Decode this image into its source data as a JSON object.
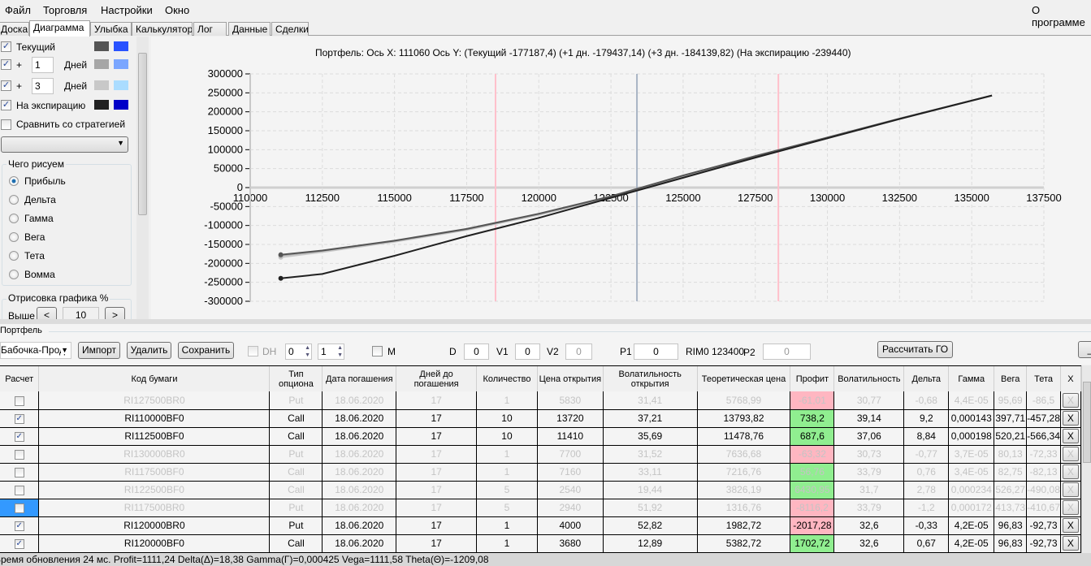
{
  "menu": {
    "items": [
      "Файл",
      "Торговля",
      "Настройки",
      "Окно"
    ],
    "about": "О программе"
  },
  "tabs": [
    "Доска",
    "Диаграмма",
    "Улыбка",
    "Калькулятор",
    "Лог",
    "Данные",
    "Сделки"
  ],
  "active_tab": "Диаграмма",
  "left_panel": {
    "current_label": "Текущий",
    "plus": "+",
    "days_label": "Дней",
    "days1": "1",
    "days2": "3",
    "expiration_label": "На экспирацию",
    "compare_label": "Сравнить со стратегией",
    "strategy_select": "",
    "colors": {
      "current": [
        "#555555",
        "#2952ff"
      ],
      "plus1": [
        "#a6a6a6",
        "#7aa6ff"
      ],
      "plus3": [
        "#c8c8c8",
        "#aadcff"
      ],
      "expiration": [
        "#202020",
        "#0000c8"
      ]
    },
    "what_group": "Чего рисуем",
    "what_options": [
      "Прибыль",
      "Дельта",
      "Гамма",
      "Вега",
      "Тета",
      "Вомма"
    ],
    "what_selected": "Прибыль",
    "draw_group": "Отрисовка графика %",
    "above_label": "Выше",
    "prev": "<",
    "next": ">",
    "draw_value": "10"
  },
  "chart_title": "Портфель: Ось X: 111060 Ось Y:  (Текущий -177187,4)  (+1 дн. -179437,14)  (+3 дн. -184139,82)  (На экспирацию -239440)",
  "chart_data": {
    "type": "line",
    "xlim": [
      110000,
      137500
    ],
    "ylim": [
      -300000,
      300000
    ],
    "x_ticks": [
      "110000",
      "112500",
      "115000",
      "117500",
      "120000",
      "122500",
      "125000",
      "127500",
      "130000",
      "132500",
      "135000",
      "137500"
    ],
    "y_ticks": [
      "300000",
      "250000",
      "200000",
      "150000",
      "100000",
      "50000",
      "0",
      "-50000",
      "-100000",
      "-150000",
      "-200000",
      "-250000",
      "-300000"
    ],
    "grid": true,
    "vertical_markers": [
      {
        "x": 118500,
        "color": "#ffc0cb"
      },
      {
        "x": 123400,
        "color": "#a8b4c4"
      },
      {
        "x": 128300,
        "color": "#ffc0cb"
      }
    ],
    "series": [
      {
        "color": "#c8c8c8",
        "x": [
          111060,
          112500,
          115000,
          117500,
          120000,
          122500,
          125000,
          127500,
          130000,
          132500,
          135700
        ],
        "y": [
          -184140,
          -170000,
          -143000,
          -112000,
          -72000,
          -26000,
          30000,
          82000,
          132000,
          182000,
          243000
        ]
      },
      {
        "color": "#a6a6a6",
        "x": [
          111060,
          112500,
          115000,
          117500,
          120000,
          122500,
          125000,
          127500,
          130000,
          132500,
          135700
        ],
        "y": [
          -179437,
          -167000,
          -141000,
          -110000,
          -70000,
          -24000,
          31000,
          83000,
          132000,
          182000,
          243000
        ]
      },
      {
        "color": "#555555",
        "x": [
          111060,
          112500,
          115000,
          117500,
          120000,
          122500,
          125000,
          127500,
          130000,
          132500,
          135700
        ],
        "y": [
          -177187,
          -166000,
          -140000,
          -109000,
          -69000,
          -23000,
          32000,
          83000,
          132000,
          182000,
          243000
        ]
      },
      {
        "color": "#202020",
        "x": [
          111060,
          112500,
          115000,
          117500,
          120000,
          122500,
          125000,
          127500,
          130000,
          132500,
          135700
        ],
        "y": [
          -239440,
          -228000,
          -180000,
          -128000,
          -80000,
          -27000,
          26000,
          79000,
          130000,
          181000,
          243000
        ]
      }
    ]
  },
  "portfolio": {
    "group_title": "Портфель",
    "strategy": "Бабочка-Прод",
    "import": "Импорт",
    "delete": "Удалить",
    "save": "Сохранить",
    "dh_label": "DH",
    "spin1": "0",
    "spin2": "1",
    "m_label": "M",
    "d_label": "D",
    "d_value": "0",
    "v1_label": "V1",
    "v1_value": "0",
    "v2_label": "V2",
    "v2_value": "0",
    "p1_label": "P1",
    "p1_value": "0",
    "rim_label": "RIM0 123400",
    "p2_label": "P2",
    "p2_value": "0",
    "calc_go": "Рассчитать ГО",
    "minimize": "_"
  },
  "table": {
    "columns": [
      "Расчет",
      "Код бумаги",
      "Тип опциона",
      "Дата погашения",
      "Дней до погашения",
      "Количество",
      "Цена открытия",
      "Волатильность открытия",
      "Теоретическая цена",
      "Профит",
      "Волатильность",
      "Дельта",
      "Гамма",
      "Вега",
      "Тета",
      "X"
    ],
    "rows": [
      {
        "checked": false,
        "code": "RI127500BR0",
        "type": "Put",
        "date": "18.06.2020",
        "days": "17",
        "qty": "1",
        "open": "5830",
        "open_vol": "31,41",
        "theo": "5768,99",
        "profit": "-61,01",
        "vol": "30,77",
        "delta": "-0,68",
        "gamma": "4,4E-05",
        "vega": "95,69",
        "theta": "-86,5",
        "x": "X"
      },
      {
        "checked": true,
        "code": "RI110000BF0",
        "type": "Call",
        "date": "18.06.2020",
        "days": "17",
        "qty": "10",
        "open": "13720",
        "open_vol": "37,21",
        "theo": "13793,82",
        "profit": "738,2",
        "vol": "39,14",
        "delta": "9,2",
        "gamma": "0,000143",
        "vega": "397,71",
        "theta": "-457,28",
        "x": "X"
      },
      {
        "checked": true,
        "code": "RI112500BF0",
        "type": "Call",
        "date": "18.06.2020",
        "days": "17",
        "qty": "10",
        "open": "11410",
        "open_vol": "35,69",
        "theo": "11478,76",
        "profit": "687,6",
        "vol": "37,06",
        "delta": "8,84",
        "gamma": "0,000198",
        "vega": "520,21",
        "theta": "-566,34",
        "x": "X"
      },
      {
        "checked": false,
        "code": "RI130000BR0",
        "type": "Put",
        "date": "18.06.2020",
        "days": "17",
        "qty": "1",
        "open": "7700",
        "open_vol": "31,52",
        "theo": "7636,68",
        "profit": "-63,32",
        "vol": "30,73",
        "delta": "-0,77",
        "gamma": "3,7E-05",
        "vega": "80,13",
        "theta": "-72,33",
        "x": "X"
      },
      {
        "checked": false,
        "code": "RI117500BF0",
        "type": "Call",
        "date": "18.06.2020",
        "days": "17",
        "qty": "1",
        "open": "7160",
        "open_vol": "33,11",
        "theo": "7216,76",
        "profit": "56,76",
        "vol": "33,79",
        "delta": "0,76",
        "gamma": "3,4E-05",
        "vega": "82,75",
        "theta": "-82,13",
        "x": "X"
      },
      {
        "checked": false,
        "code": "RI122500BF0",
        "type": "Call",
        "date": "18.06.2020",
        "days": "17",
        "qty": "5",
        "open": "2540",
        "open_vol": "19,44",
        "theo": "3826,19",
        "profit": "6430,95",
        "vol": "31,7",
        "delta": "2,78",
        "gamma": "0,000234",
        "vega": "526,27",
        "theta": "-490,08",
        "x": "X"
      },
      {
        "checked": false,
        "selected": true,
        "code": "RI117500BR0",
        "type": "Put",
        "date": "18.06.2020",
        "days": "17",
        "qty": "5",
        "open": "2940",
        "open_vol": "51,92",
        "theo": "1316,76",
        "profit": "-8116,2",
        "vol": "33,79",
        "delta": "-1,2",
        "gamma": "0,000172",
        "vega": "413,73",
        "theta": "-410,67",
        "x": "X"
      },
      {
        "checked": true,
        "code": "RI120000BR0",
        "type": "Put",
        "date": "18.06.2020",
        "days": "17",
        "qty": "1",
        "open": "4000",
        "open_vol": "52,82",
        "theo": "1982,72",
        "profit": "-2017,28",
        "vol": "32,6",
        "delta": "-0,33",
        "gamma": "4,2E-05",
        "vega": "96,83",
        "theta": "-92,73",
        "x": "X"
      },
      {
        "checked": true,
        "code": "RI120000BF0",
        "type": "Call",
        "date": "18.06.2020",
        "days": "17",
        "qty": "1",
        "open": "3680",
        "open_vol": "12,89",
        "theo": "5382,72",
        "profit": "1702,72",
        "vol": "32,6",
        "delta": "0,67",
        "gamma": "4,2E-05",
        "vega": "96,83",
        "theta": "-92,73",
        "x": "X"
      }
    ]
  },
  "status": "Время обновления 24 мс. Profit=1111,24 Delta(Δ)=18,38 Gamma(Γ)=0,000425 Vega=1111,58 Theta(Θ)=-1209,08"
}
